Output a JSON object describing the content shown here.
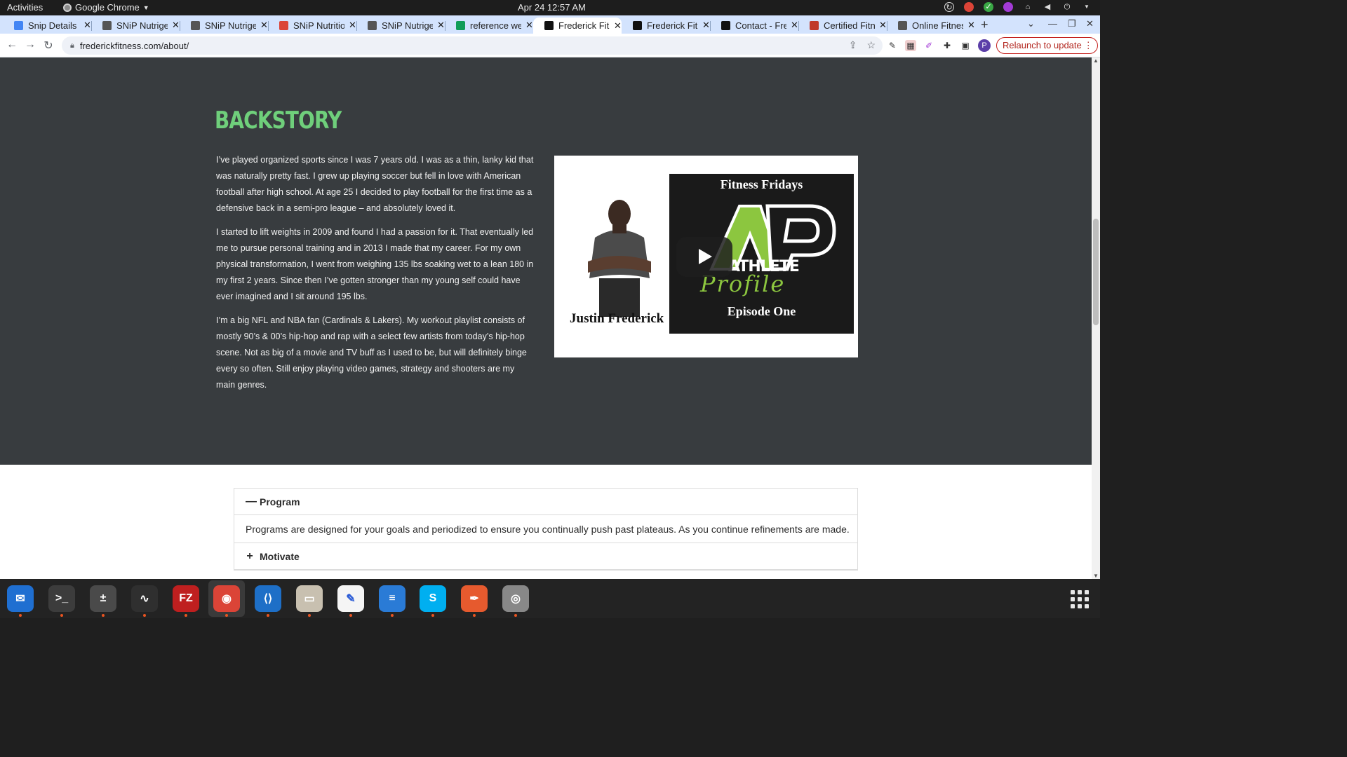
{
  "topbar": {
    "activities": "Activities",
    "app_name": "Google Chrome",
    "clock": "Apr 24  12:57 AM"
  },
  "tabs": [
    {
      "title": "Snip Details -",
      "icon": "docs-icon",
      "color": "#4285f4"
    },
    {
      "title": "SNiP Nutrige",
      "icon": "snip-logo-icon",
      "color": "#555555"
    },
    {
      "title": "SNiP Nutrige",
      "icon": "snip-logo-icon",
      "color": "#555555"
    },
    {
      "title": "SNiP Nutritio",
      "icon": "chrome-icon",
      "color": "#db4437"
    },
    {
      "title": "SNiP Nutrige",
      "icon": "snip-logo-icon",
      "color": "#555555"
    },
    {
      "title": "reference we",
      "icon": "sheets-icon",
      "color": "#0f9d58"
    },
    {
      "title": "Frederick Fitn",
      "icon": "ff-logo-icon",
      "color": "#111111",
      "active": true
    },
    {
      "title": "Frederick Fitr",
      "icon": "ff-logo-icon",
      "color": "#111111"
    },
    {
      "title": "Contact - Fre",
      "icon": "ff-logo-icon",
      "color": "#111111"
    },
    {
      "title": "Certified Fitn",
      "icon": "cert-icon",
      "color": "#c0392b"
    },
    {
      "title": "Online Fitnes",
      "icon": "globe-icon",
      "color": "#555555"
    }
  ],
  "toolbar": {
    "url": "frederickfitness.com/about/",
    "relaunch_label": "Relaunch to update",
    "profile_initial": "P"
  },
  "page": {
    "heading": "BACKSTORY",
    "heading_color": "#6fcf7b",
    "paragraphs": [
      "I’ve played organized sports since I was 7 years old. I was as a thin, lanky kid that was naturally pretty fast. I grew up playing soccer but fell in love with American football after high school. At age 25 I decided to play football for the first time as a defensive back in a semi-pro league – and absolutely loved it.",
      "I started to lift weights in 2009 and found I had a passion for it.  That eventually led me to pursue personal training and in 2013 I made that my career. For my own physical transformation, I went from weighing 135 lbs soaking wet to a lean 180 in my first 2 years. Since then I’ve gotten stronger than my young self could have ever imagined and I sit around 195 lbs.",
      "I’m a big NFL and NBA fan (Cardinals & Lakers).  My workout playlist consists of mostly 90’s & 00’s hip-hop and rap with a select few artists from today’s hip-hop scene. Not as big of a movie and TV buff as I used to be, but will definitely binge every so often. Still enjoy playing video games, strategy and shooters are my main genres."
    ],
    "video": {
      "athlete_name": "Justin Frederick",
      "series_title": "Fitness Fridays",
      "logo_letters": "AP",
      "brand_word": "ATHLETE",
      "brand_script": "Profile",
      "episode": "Episode One"
    },
    "accordion": [
      {
        "title": "Program",
        "expanded": true,
        "sign": "—",
        "body": "Programs are designed for your goals and periodized to ensure you continually push past plateaus. As you continue refinements are made."
      },
      {
        "title": "Motivate",
        "expanded": false,
        "sign": "+"
      }
    ]
  },
  "dock": [
    {
      "name": "thunderbird-icon",
      "glyph": "✉",
      "bg": "#1f6fd1"
    },
    {
      "name": "terminal-icon",
      "glyph": ">_",
      "bg": "#3c3c3c"
    },
    {
      "name": "calculator-icon",
      "glyph": "±",
      "bg": "#4a4a4a"
    },
    {
      "name": "system-monitor-icon",
      "glyph": "∿",
      "bg": "#2f2f2f"
    },
    {
      "name": "filezilla-icon",
      "glyph": "FZ",
      "bg": "#bf1f1f"
    },
    {
      "name": "chrome-icon",
      "glyph": "◉",
      "bg": "#db4437"
    },
    {
      "name": "vscode-icon",
      "glyph": "⟨⟩",
      "bg": "#1e6fc7"
    },
    {
      "name": "files-icon",
      "glyph": "▭",
      "bg": "#c8c0b0"
    },
    {
      "name": "text-editor-icon",
      "glyph": "✎",
      "bg": "#f5f5f5"
    },
    {
      "name": "libreoffice-writer-icon",
      "glyph": "≡",
      "bg": "#2a7bd6"
    },
    {
      "name": "skype-icon",
      "glyph": "S",
      "bg": "#00aff0"
    },
    {
      "name": "inkscape-icon",
      "glyph": "✒",
      "bg": "#e65a2e"
    },
    {
      "name": "disk-icon",
      "glyph": "◎",
      "bg": "#888888"
    }
  ]
}
